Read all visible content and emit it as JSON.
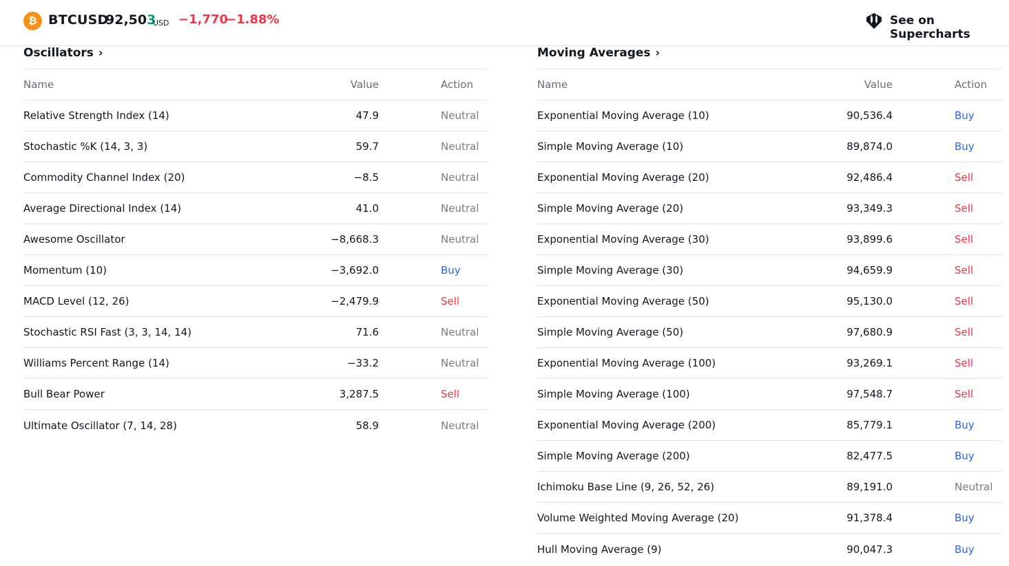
{
  "header": {
    "coin_glyph": "₿",
    "symbol": "BTCUSD",
    "price_main": "92,50",
    "price_last_digit": "3",
    "currency": "USD",
    "change": "−1,770",
    "change_percent": "−1.88%",
    "supercharts_label": "See on Supercharts"
  },
  "colors": {
    "neutral": "#787b86",
    "buy": "#2962ff",
    "sell": "#f23645",
    "coin": "#f7931a",
    "price_up": "#089981"
  },
  "oscillators": {
    "title": "Oscillators",
    "columns": {
      "name": "Name",
      "value": "Value",
      "action": "Action"
    },
    "rows": [
      {
        "name": "Relative Strength Index (14)",
        "value": "47.9",
        "action": "Neutral"
      },
      {
        "name": "Stochastic %K (14, 3, 3)",
        "value": "59.7",
        "action": "Neutral"
      },
      {
        "name": "Commodity Channel Index (20)",
        "value": "−8.5",
        "action": "Neutral"
      },
      {
        "name": "Average Directional Index (14)",
        "value": "41.0",
        "action": "Neutral"
      },
      {
        "name": "Awesome Oscillator",
        "value": "−8,668.3",
        "action": "Neutral"
      },
      {
        "name": "Momentum (10)",
        "value": "−3,692.0",
        "action": "Buy"
      },
      {
        "name": "MACD Level (12, 26)",
        "value": "−2,479.9",
        "action": "Sell"
      },
      {
        "name": "Stochastic RSI Fast (3, 3, 14, 14)",
        "value": "71.6",
        "action": "Neutral"
      },
      {
        "name": "Williams Percent Range (14)",
        "value": "−33.2",
        "action": "Neutral"
      },
      {
        "name": "Bull Bear Power",
        "value": "3,287.5",
        "action": "Sell"
      },
      {
        "name": "Ultimate Oscillator (7, 14, 28)",
        "value": "58.9",
        "action": "Neutral"
      }
    ]
  },
  "moving_averages": {
    "title": "Moving Averages",
    "columns": {
      "name": "Name",
      "value": "Value",
      "action": "Action"
    },
    "rows": [
      {
        "name": "Exponential Moving Average (10)",
        "value": "90,536.4",
        "action": "Buy"
      },
      {
        "name": "Simple Moving Average (10)",
        "value": "89,874.0",
        "action": "Buy"
      },
      {
        "name": "Exponential Moving Average (20)",
        "value": "92,486.4",
        "action": "Sell"
      },
      {
        "name": "Simple Moving Average (20)",
        "value": "93,349.3",
        "action": "Sell"
      },
      {
        "name": "Exponential Moving Average (30)",
        "value": "93,899.6",
        "action": "Sell"
      },
      {
        "name": "Simple Moving Average (30)",
        "value": "94,659.9",
        "action": "Sell"
      },
      {
        "name": "Exponential Moving Average (50)",
        "value": "95,130.0",
        "action": "Sell"
      },
      {
        "name": "Simple Moving Average (50)",
        "value": "97,680.9",
        "action": "Sell"
      },
      {
        "name": "Exponential Moving Average (100)",
        "value": "93,269.1",
        "action": "Sell"
      },
      {
        "name": "Simple Moving Average (100)",
        "value": "97,548.7",
        "action": "Sell"
      },
      {
        "name": "Exponential Moving Average (200)",
        "value": "85,779.1",
        "action": "Buy"
      },
      {
        "name": "Simple Moving Average (200)",
        "value": "82,477.5",
        "action": "Buy"
      },
      {
        "name": "Ichimoku Base Line (9, 26, 52, 26)",
        "value": "89,191.0",
        "action": "Neutral"
      },
      {
        "name": "Volume Weighted Moving Average (20)",
        "value": "91,378.4",
        "action": "Buy"
      },
      {
        "name": "Hull Moving Average (9)",
        "value": "90,047.3",
        "action": "Buy"
      }
    ]
  }
}
